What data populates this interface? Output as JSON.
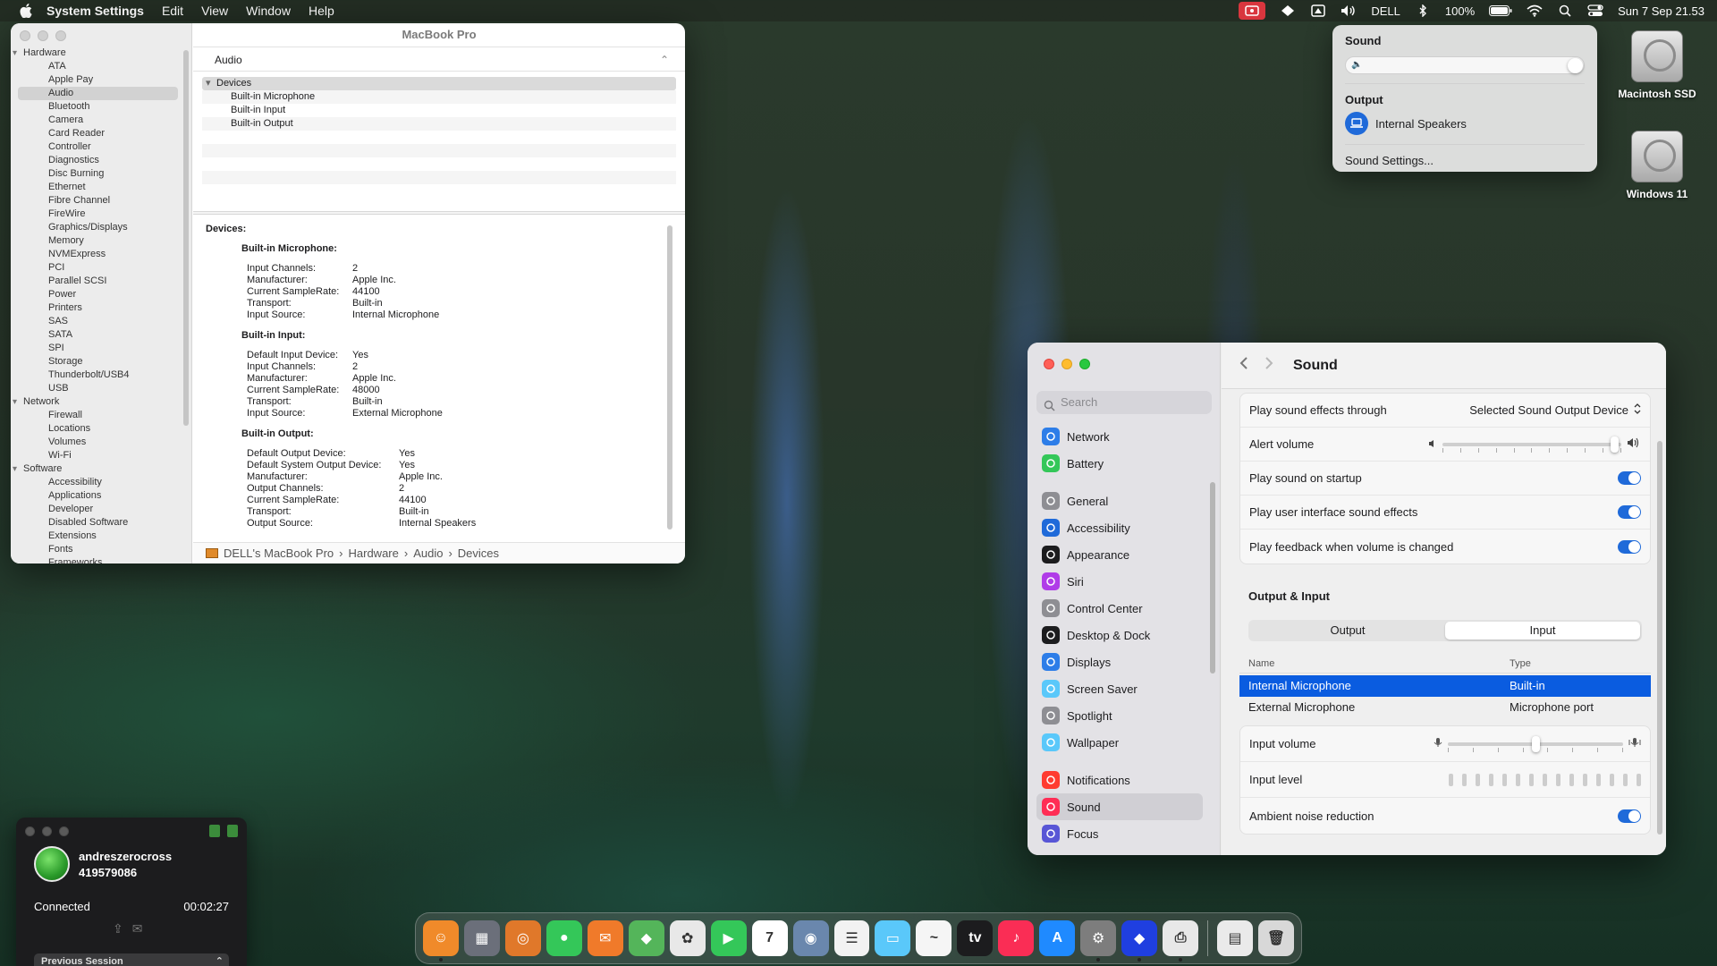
{
  "menubar": {
    "app_name": "System Settings",
    "items": [
      "Edit",
      "View",
      "Window",
      "Help"
    ],
    "status_label": "DELL",
    "battery": "100%",
    "clock": "Sun 7 Sep  21.53"
  },
  "sysinfo": {
    "window_title": "MacBook Pro",
    "section_header": "Audio",
    "tree": [
      {
        "group": "Hardware",
        "items": [
          "ATA",
          "Apple Pay",
          "Audio",
          "Bluetooth",
          "Camera",
          "Card Reader",
          "Controller",
          "Diagnostics",
          "Disc Burning",
          "Ethernet",
          "Fibre Channel",
          "FireWire",
          "Graphics/Displays",
          "Memory",
          "NVMExpress",
          "PCI",
          "Parallel SCSI",
          "Power",
          "Printers",
          "SAS",
          "SATA",
          "SPI",
          "Storage",
          "Thunderbolt/USB4",
          "USB"
        ]
      },
      {
        "group": "Network",
        "items": [
          "Firewall",
          "Locations",
          "Volumes",
          "Wi-Fi"
        ]
      },
      {
        "group": "Software",
        "items": [
          "Accessibility",
          "Applications",
          "Developer",
          "Disabled Software",
          "Extensions",
          "Fonts",
          "Frameworks"
        ]
      }
    ],
    "selected_item": "Audio",
    "device_list": {
      "header": "Devices",
      "rows": [
        "Built-in Microphone",
        "Built-in Input",
        "Built-in Output"
      ]
    },
    "detail": {
      "heading": "Devices:",
      "sections": [
        {
          "title": "Built-in Microphone:",
          "wide": false,
          "props": [
            [
              "Input Channels:",
              "2"
            ],
            [
              "Manufacturer:",
              "Apple Inc."
            ],
            [
              "Current SampleRate:",
              "44100"
            ],
            [
              "Transport:",
              "Built-in"
            ],
            [
              "Input Source:",
              "Internal Microphone"
            ]
          ]
        },
        {
          "title": "Built-in Input:",
          "wide": false,
          "props": [
            [
              "Default Input Device:",
              "Yes"
            ],
            [
              "Input Channels:",
              "2"
            ],
            [
              "Manufacturer:",
              "Apple Inc."
            ],
            [
              "Current SampleRate:",
              "48000"
            ],
            [
              "Transport:",
              "Built-in"
            ],
            [
              "Input Source:",
              "External Microphone"
            ]
          ]
        },
        {
          "title": "Built-in Output:",
          "wide": true,
          "props": [
            [
              "Default Output Device:",
              "Yes"
            ],
            [
              "Default System Output Device:",
              "Yes"
            ],
            [
              "Manufacturer:",
              "Apple Inc."
            ],
            [
              "Output Channels:",
              "2"
            ],
            [
              "Current SampleRate:",
              "44100"
            ],
            [
              "Transport:",
              "Built-in"
            ],
            [
              "Output Source:",
              "Internal Speakers"
            ]
          ]
        }
      ]
    },
    "path": [
      "DELL's MacBook Pro",
      "Hardware",
      "Audio",
      "Devices"
    ]
  },
  "sound_menu": {
    "title": "Sound",
    "volume_fraction": 1.0,
    "output_label": "Output",
    "device": "Internal Speakers",
    "settings_link": "Sound Settings..."
  },
  "desktop": {
    "drives": [
      "Macintosh SSD",
      "Windows 11"
    ]
  },
  "settings": {
    "search_placeholder": "Search",
    "title": "Sound",
    "nav": [
      {
        "label": "Network",
        "color": "#2d7de8",
        "icon": "globe-icon"
      },
      {
        "label": "Battery",
        "color": "#34c759",
        "icon": "battery-icon"
      },
      {
        "label": "General",
        "color": "#8e8e93",
        "icon": "gear-icon"
      },
      {
        "label": "Accessibility",
        "color": "#1f6ad9",
        "icon": "accessibility-icon"
      },
      {
        "label": "Appearance",
        "color": "#1c1c1e",
        "icon": "appearance-icon"
      },
      {
        "label": "Siri",
        "color": "#b03ce8",
        "icon": "siri-icon"
      },
      {
        "label": "Control Center",
        "color": "#8e8e93",
        "icon": "control-center-icon"
      },
      {
        "label": "Desktop & Dock",
        "color": "#1c1c1e",
        "icon": "dock-icon"
      },
      {
        "label": "Displays",
        "color": "#2d7de8",
        "icon": "display-icon"
      },
      {
        "label": "Screen Saver",
        "color": "#5ac8fa",
        "icon": "screensaver-icon"
      },
      {
        "label": "Spotlight",
        "color": "#8e8e93",
        "icon": "spotlight-icon"
      },
      {
        "label": "Wallpaper",
        "color": "#5ac8fa",
        "icon": "wallpaper-icon"
      },
      {
        "label": "Notifications",
        "color": "#ff3b30",
        "icon": "bell-icon"
      },
      {
        "label": "Sound",
        "color": "#ff2d55",
        "icon": "speaker-icon"
      },
      {
        "label": "Focus",
        "color": "#5856d6",
        "icon": "moon-icon"
      }
    ],
    "selected_nav": "Sound",
    "rows": {
      "effects_label": "Play sound effects through",
      "effects_value": "Selected Sound Output Device",
      "alert_label": "Alert volume",
      "alert_fraction": 0.96,
      "startup_label": "Play sound on startup",
      "ui_effects_label": "Play user interface sound effects",
      "feedback_label": "Play feedback when volume is changed"
    },
    "output_input": {
      "section_title": "Output & Input",
      "tabs": [
        "Output",
        "Input"
      ],
      "selected_tab": "Input",
      "col_name": "Name",
      "col_type": "Type",
      "devices": [
        {
          "name": "Internal Microphone",
          "type": "Built-in",
          "selected": true
        },
        {
          "name": "External Microphone",
          "type": "Microphone port",
          "selected": false
        }
      ],
      "input_volume_label": "Input volume",
      "input_volume_fraction": 0.5,
      "input_level_label": "Input level",
      "noise_label": "Ambient noise reduction"
    },
    "accent": "#0a5ce0"
  },
  "remote": {
    "user": "andreszerocross",
    "id": "419579086",
    "status": "Connected",
    "elapsed": "00:02:27",
    "previous": "Previous Session"
  },
  "dock": {
    "apps": [
      {
        "name": "finder",
        "color": "#f08a2a",
        "glyph": "☺"
      },
      {
        "name": "launchpad",
        "color": "#6b6f7a",
        "glyph": "▦"
      },
      {
        "name": "safari",
        "color": "#e0782a",
        "glyph": "◎"
      },
      {
        "name": "messages",
        "color": "#34c759",
        "glyph": "●"
      },
      {
        "name": "mail",
        "color": "#f07a2a",
        "glyph": "✉"
      },
      {
        "name": "maps",
        "color": "#54b55a",
        "glyph": "◆"
      },
      {
        "name": "photos",
        "color": "#e8e8e8",
        "glyph": "✿"
      },
      {
        "name": "facetime",
        "color": "#34c759",
        "glyph": "▶"
      },
      {
        "name": "calendar",
        "color": "#ffffff",
        "glyph": "7"
      },
      {
        "name": "contacts",
        "color": "#6a87ad",
        "glyph": "◉"
      },
      {
        "name": "reminders",
        "color": "#f2f2f2",
        "glyph": "☰"
      },
      {
        "name": "notes",
        "color": "#5ac8fa",
        "glyph": "▭"
      },
      {
        "name": "freeform",
        "color": "#f5f5f5",
        "glyph": "~"
      },
      {
        "name": "apple-tv",
        "color": "#1c1c1e",
        "glyph": "tv"
      },
      {
        "name": "music",
        "color": "#fa2d55",
        "glyph": "♪"
      },
      {
        "name": "app-store",
        "color": "#1f8aff",
        "glyph": "A"
      },
      {
        "name": "system-settings",
        "color": "#7d7d7d",
        "glyph": "⚙"
      },
      {
        "name": "remote-desktop",
        "color": "#1f3fe0",
        "glyph": "◆"
      },
      {
        "name": "printer",
        "color": "#e8e8e8",
        "glyph": "⎙"
      },
      {
        "name": "document",
        "color": "#eaeaea",
        "glyph": "▤"
      },
      {
        "name": "trash",
        "color": "#d8d8d8",
        "glyph": "🗑"
      }
    ]
  }
}
